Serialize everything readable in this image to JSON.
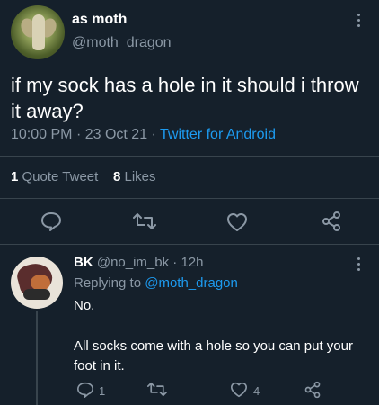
{
  "tweet": {
    "display_name": "as moth",
    "handle": "@moth_dragon",
    "text": "if my sock has a hole in it should i throw it away?",
    "time": "10:00 PM",
    "sep1": "·",
    "date": "23 Oct 21",
    "sep2": "·",
    "client": "Twitter for Android",
    "quote_count": "1",
    "quote_label": "Quote Tweet",
    "like_count": "8",
    "like_label": "Likes"
  },
  "reply": {
    "display_name": "BK",
    "handle": "@no_im_bk",
    "sep": "·",
    "age": "12h",
    "replying_prefix": "Replying to",
    "replying_to": "@moth_dragon",
    "line1": "No.",
    "line2": "All socks come with a hole so you can put your foot in it.",
    "reply_count": "1",
    "like_count": "4"
  },
  "icons": {
    "reply": "speech-bubble-icon",
    "retweet": "retweet-icon",
    "like": "heart-icon",
    "share": "share-icon",
    "more": "more-dots-icon"
  },
  "colors": {
    "background": "#15202b",
    "muted": "#8b98a5",
    "link": "#1d9bf0",
    "divider": "#38444d"
  }
}
